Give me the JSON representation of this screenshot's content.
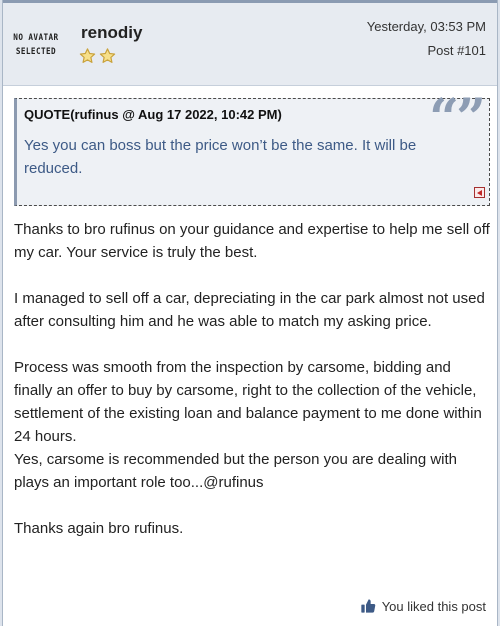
{
  "author": {
    "avatar_placeholder_line1": "NO AVATAR",
    "avatar_placeholder_line2": "SELECTED",
    "username": "renodiy",
    "rank_stars": 2
  },
  "post": {
    "date": "Yesterday, 03:53 PM",
    "number": "Post #101"
  },
  "quote": {
    "header": "QUOTE(rufinus @ Aug 17 2022, 10:42 PM)",
    "text": "Yes you can boss but the price won’t be the same. It will be reduced."
  },
  "body": {
    "paragraphs": [
      "Thanks to bro rufinus on your guidance and expertise to help me sell off my car. Your service is truly the best.",
      "I managed to sell off a car, depreciating in the car park almost not used after consulting him and he was able to match my asking price.",
      "Process was smooth from the inspection by carsome, bidding and finally an offer to buy by carsome, right to the collection of the vehicle, settlement of the existing loan and balance payment to me done within 24 hours.\nYes, carsome is recommended but the person you are dealing with plays an important role too...@rufinus",
      "Thanks again bro rufinus."
    ]
  },
  "footer": {
    "liked_label": "You liked this post"
  },
  "colors": {
    "quote_text": "#3d5a86",
    "header_bg": "#e7ebf1",
    "star_fill": "#f7e08a",
    "star_stroke": "#c9a23c",
    "thumb": "#3d5a86"
  },
  "icons": {
    "rank": "star-icon",
    "quote": "quote-marks-icon",
    "jump": "jump-to-post-icon",
    "like": "thumbs-up-icon"
  }
}
